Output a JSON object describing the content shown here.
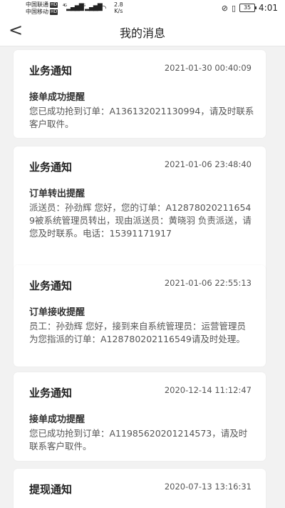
{
  "status_bar": {
    "carrier1": "中国联通",
    "carrier2": "中国移动",
    "hd": "HD",
    "net1": "4G",
    "net2": "4G",
    "speed_value": "2.8",
    "speed_unit": "K/s",
    "battery": "35",
    "time": "4:01"
  },
  "header": {
    "back": "<",
    "title": "我的消息"
  },
  "messages": [
    {
      "type": "业务通知",
      "time": "2021-01-30 00:40:09",
      "subject": "接单成功提醒",
      "body": "您已成功抢到订单：A136132021130994，请及时联系客户取件。"
    },
    {
      "type": "业务通知",
      "time": "2021-01-06 23:48:40",
      "subject": "订单转出提醒",
      "body": "派送员：孙劲辉 您好，您的订单：A128780202116549被系统管理员转出，现由派送员：黄晓羽 负责派送，请您及时联系。电话：15391171917"
    },
    {
      "type": "业务通知",
      "time": "2021-01-06 22:55:13",
      "subject": "订单接收提醒",
      "body": "员工：孙劲辉 您好，接到来自系统管理员：运营管理员 为您指派的订单：A128780202116549请及时处理。"
    },
    {
      "type": "业务通知",
      "time": "2020-12-14 11:12:47",
      "subject": "接单成功提醒",
      "body": "您已成功抢到订单：A11985620201214573，请及时联系客户取件。"
    },
    {
      "type": "提现通知",
      "time": "2020-07-13 13:16:31",
      "subject": "",
      "body": ""
    }
  ]
}
